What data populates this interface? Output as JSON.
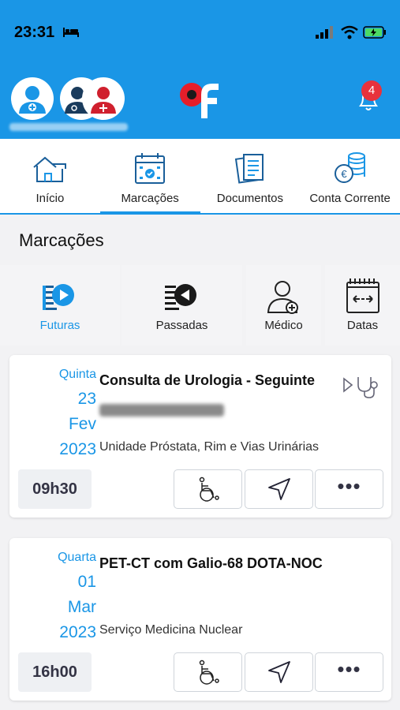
{
  "status": {
    "time": "23:31"
  },
  "header": {
    "notification_count": "4",
    "logo": "cf"
  },
  "tabs": [
    {
      "label": "Início",
      "icon": "home-icon"
    },
    {
      "label": "Marcações",
      "icon": "calendar-icon",
      "active": true
    },
    {
      "label": "Documentos",
      "icon": "documents-icon"
    },
    {
      "label": "Conta Corrente",
      "icon": "coins-icon"
    }
  ],
  "page": {
    "title": "Marcações"
  },
  "filters": [
    {
      "label": "Futuras",
      "icon": "play-list-icon",
      "active": true
    },
    {
      "label": "Passadas",
      "icon": "rewind-list-icon"
    },
    {
      "label": "Médico",
      "icon": "doctor-icon"
    },
    {
      "label": "Datas",
      "icon": "date-range-icon"
    }
  ],
  "appointments": [
    {
      "weekday": "Quinta",
      "day": "23",
      "month": "Fev",
      "year": "2023",
      "title": "Consulta de Urologia - Seguinte",
      "unit": "Unidade Próstata, Rim e Vias Urinárias",
      "time": "09h30",
      "has_stethoscope": true
    },
    {
      "weekday": "Quarta",
      "day": "01",
      "month": "Mar",
      "year": "2023",
      "title": "PET-CT com Galio-68 DOTA-NOC",
      "unit": "Serviço Medicina Nuclear",
      "time": "16h00",
      "has_stethoscope": false
    }
  ],
  "actions": {
    "more": "•••"
  },
  "colors": {
    "brand": "#1a96e6",
    "badge": "#e8323c",
    "logo_red": "#e51e2a"
  }
}
